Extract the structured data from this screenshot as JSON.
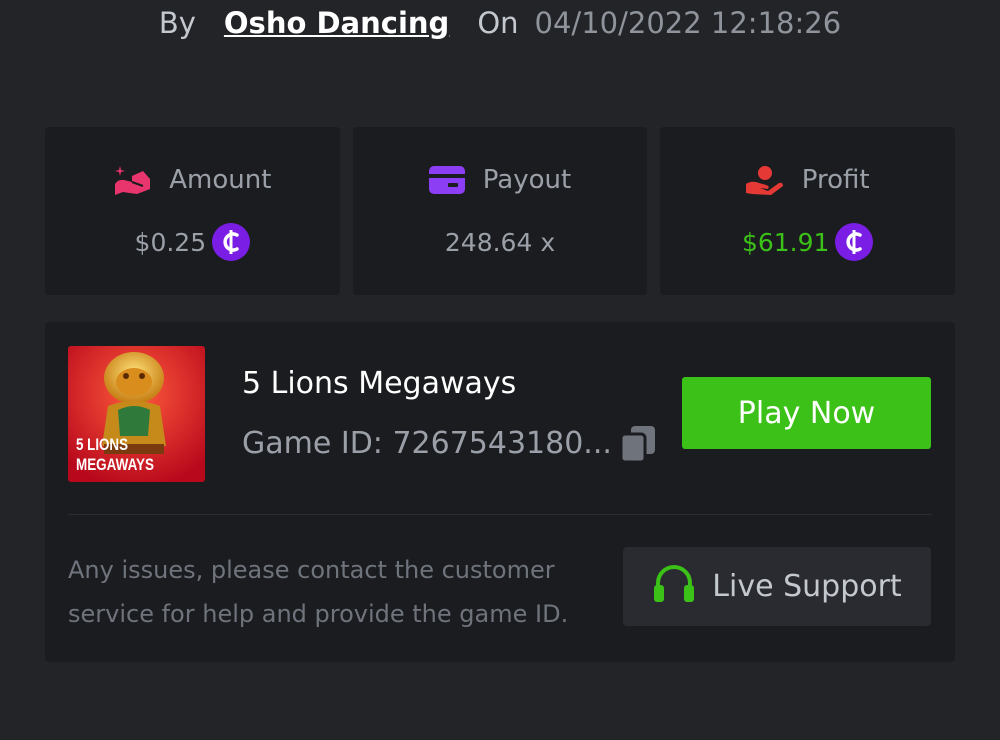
{
  "header": {
    "by_label": "By",
    "username": "Osho Dancing",
    "on_label": "On",
    "datetime": "04/10/2022 12:18:26"
  },
  "stats": {
    "amount": {
      "label": "Amount",
      "value": "$0.25",
      "icon": "amount-hand-icon",
      "color": "#e8356d"
    },
    "payout": {
      "label": "Payout",
      "value": "248.64 x",
      "icon": "credit-card-icon",
      "color": "#8c3ef5"
    },
    "profit": {
      "label": "Profit",
      "value": "$61.91",
      "icon": "money-hand-icon",
      "color": "#e53935",
      "value_color": "#3bc117"
    }
  },
  "game": {
    "title": "5 Lions Megaways",
    "id_text": "Game ID: 7267543180...",
    "thumb_text_1": "5 LIONS",
    "thumb_text_2": "MEGAWAYS",
    "play_label": "Play Now"
  },
  "support": {
    "help_text": "Any issues, please contact the customer service for help and provide the game ID.",
    "button_label": "Live Support"
  },
  "colors": {
    "accent_green": "#3bc117",
    "coin_purple": "#7a1ee6",
    "background": "#232428",
    "panel": "#1b1c20"
  }
}
